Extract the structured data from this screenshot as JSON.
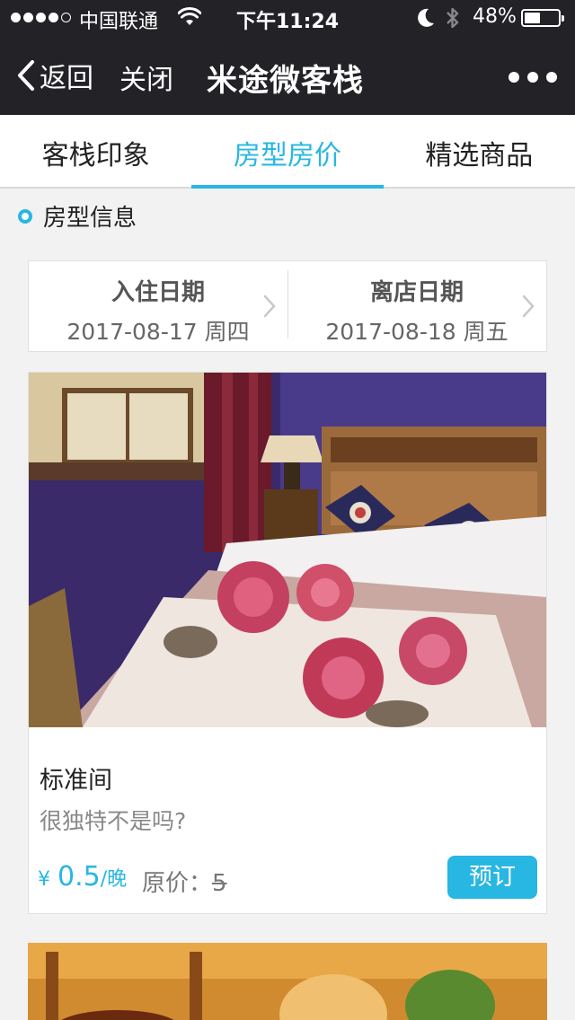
{
  "status_bar": {
    "carrier": "中国联通",
    "time": "下午11:24",
    "battery_percent_text": "48%",
    "battery_level": 0.48,
    "signal_bars_filled": 4,
    "signal_bars_total": 5
  },
  "nav": {
    "back_label": "返回",
    "close_label": "关闭",
    "title": "米途微客栈"
  },
  "tabs": [
    {
      "label": "客栈印象",
      "active": false
    },
    {
      "label": "房型房价",
      "active": true
    },
    {
      "label": "精选商品",
      "active": false
    }
  ],
  "section": {
    "title": "房型信息"
  },
  "dates": {
    "checkin": {
      "label": "入住日期",
      "value": "2017-08-17 周四"
    },
    "checkout": {
      "label": "离店日期",
      "value": "2017-08-18 周五"
    }
  },
  "rooms": [
    {
      "name": "标准间",
      "description": "很独特不是吗?",
      "currency": "¥",
      "price": "0.5",
      "unit": "/晚",
      "original_label": "原价：",
      "original_price": "5",
      "book_label": "预订"
    }
  ],
  "colors": {
    "accent": "#27b7e2",
    "header_bg": "#232227",
    "page_bg": "#f2f2f2"
  }
}
